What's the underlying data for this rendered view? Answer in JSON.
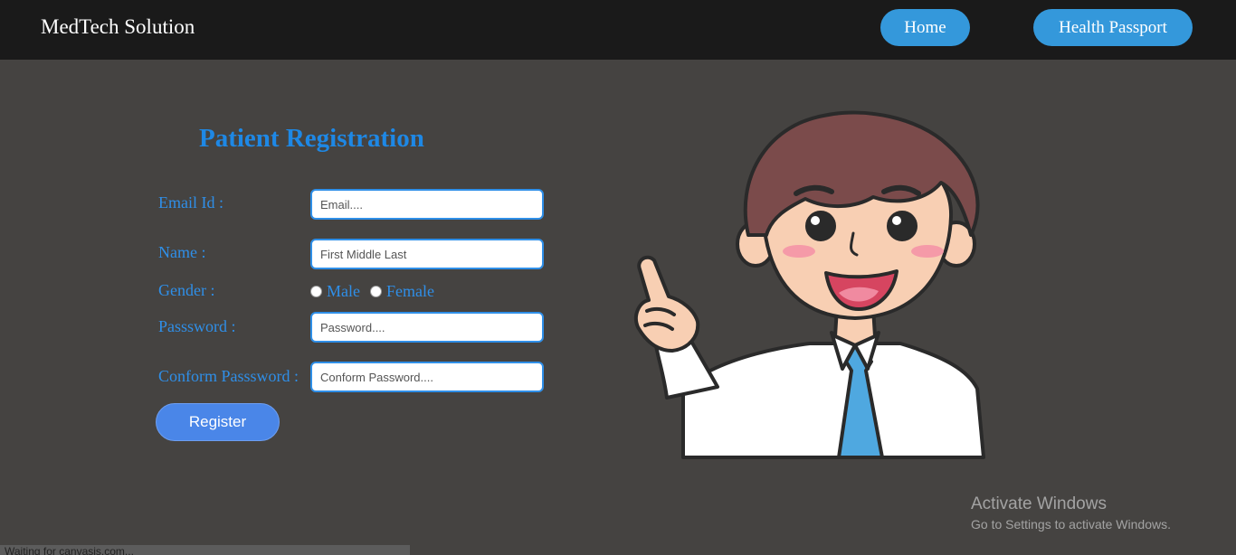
{
  "header": {
    "brand": "MedTech Solution",
    "nav": {
      "home": "Home",
      "health_passport": "Health Passport"
    }
  },
  "form": {
    "title": "Patient Registration",
    "email": {
      "label": "Email Id :",
      "placeholder": "Email...."
    },
    "name": {
      "label": "Name :",
      "placeholder": "First Middle Last"
    },
    "gender": {
      "label": "Gender :",
      "options": [
        "Male",
        "Female"
      ]
    },
    "password": {
      "label": "Passsword :",
      "placeholder": "Password...."
    },
    "confirm": {
      "label": "Conform Passsword :",
      "placeholder": "Conform Password...."
    },
    "register_label": "Register"
  },
  "illustration": {
    "icon": "pointing-man-illustration"
  },
  "watermark": {
    "title": "Activate Windows",
    "subtitle": "Go to Settings to activate Windows."
  },
  "status": {
    "text": "Waiting for canvasjs.com..."
  },
  "colors": {
    "topbar": "#1a1a1a",
    "background": "#454341",
    "accent": "#3498db",
    "label": "#2f8fe8",
    "register": "#4a86e8"
  }
}
